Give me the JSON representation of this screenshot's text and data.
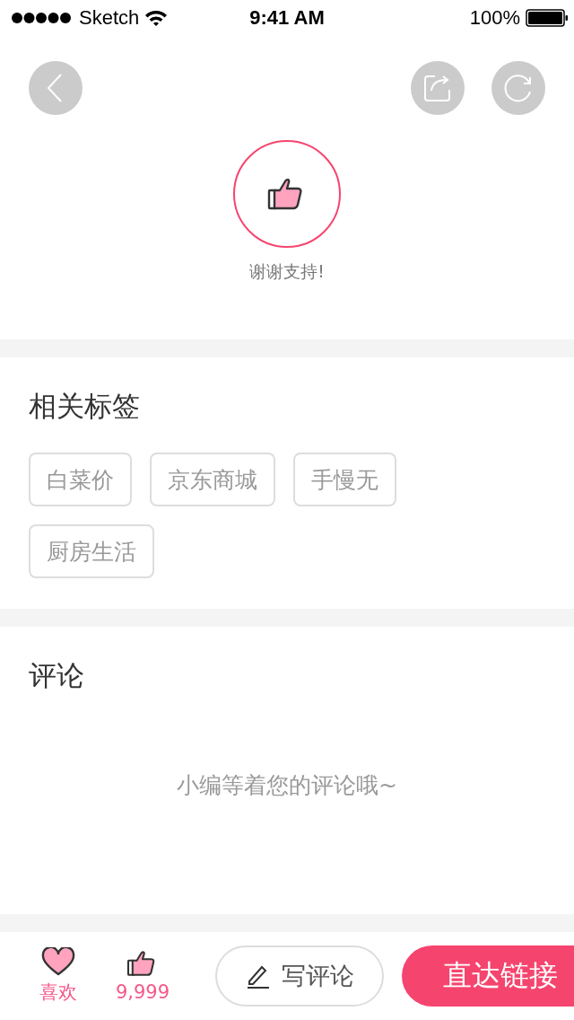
{
  "status_bar": {
    "carrier": "Sketch",
    "time": "9:41 AM",
    "battery": "100%"
  },
  "like_card": {
    "message": "谢谢支持!"
  },
  "tags_section": {
    "title": "相关标签",
    "tags": [
      "白菜价",
      "京东商城",
      "手慢无",
      "厨房生活"
    ]
  },
  "comments_section": {
    "title": "评论",
    "empty_text": "小编等着您的评论哦~"
  },
  "bottom_bar": {
    "favorite_label": "喜欢",
    "like_count": "9,999",
    "comment_button": "写评论",
    "link_button": "直达链接"
  }
}
